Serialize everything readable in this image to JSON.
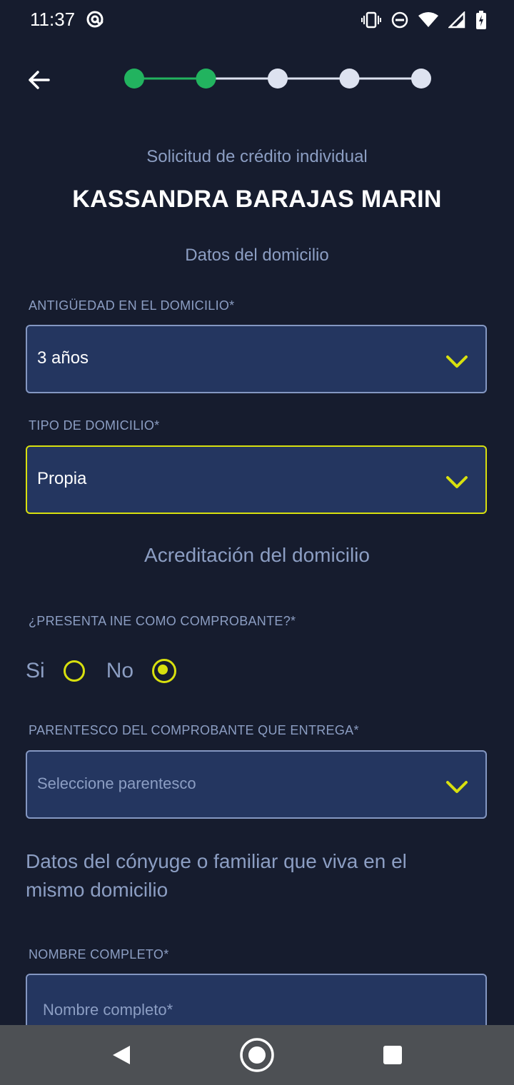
{
  "status_bar": {
    "time": "11:37",
    "icons": [
      "at-icon",
      "vibrate-icon",
      "dnd-icon",
      "wifi-icon",
      "signal-icon",
      "battery-icon"
    ]
  },
  "stepper": {
    "total_steps": 5,
    "completed_steps": 2,
    "colors": {
      "done": "#22b35f",
      "pending": "#dde2f0"
    }
  },
  "header": {
    "subtitle": "Solicitud de crédito individual",
    "applicant_name": "KASSANDRA BARAJAS MARIN"
  },
  "section_domicilio": {
    "title": "Datos del domicilio",
    "antiguedad": {
      "label": "ANTIGÜEDAD EN EL DOMICILIO*",
      "value": "3 años"
    },
    "tipo": {
      "label": "TIPO DE DOMICILIO*",
      "value": "Propia"
    }
  },
  "section_acreditacion": {
    "title": "Acreditación del domicilio",
    "ine_question": "¿PRESENTA INE COMO COMPROBANTE?*",
    "options": [
      {
        "label": "Si",
        "checked": false
      },
      {
        "label": "No",
        "checked": true
      }
    ],
    "parentesco": {
      "label": "PARENTESCO DEL COMPROBANTE QUE ENTREGA*",
      "placeholder": "Seleccione parentesco"
    }
  },
  "section_conyuge": {
    "title": "Datos del cónyuge o familiar que viva en el mismo domicilio",
    "nombre": {
      "label": "NOMBRE COMPLETO*",
      "placeholder": "Nombre completo*"
    }
  },
  "colors": {
    "background": "#161c2e",
    "field_bg": "#243660",
    "accent": "#d8e00e",
    "muted_text": "#8c9ec3",
    "nav_bar": "#4d5054"
  },
  "nav_bar": {
    "buttons": [
      "back-nav",
      "home-nav",
      "recents-nav"
    ]
  }
}
